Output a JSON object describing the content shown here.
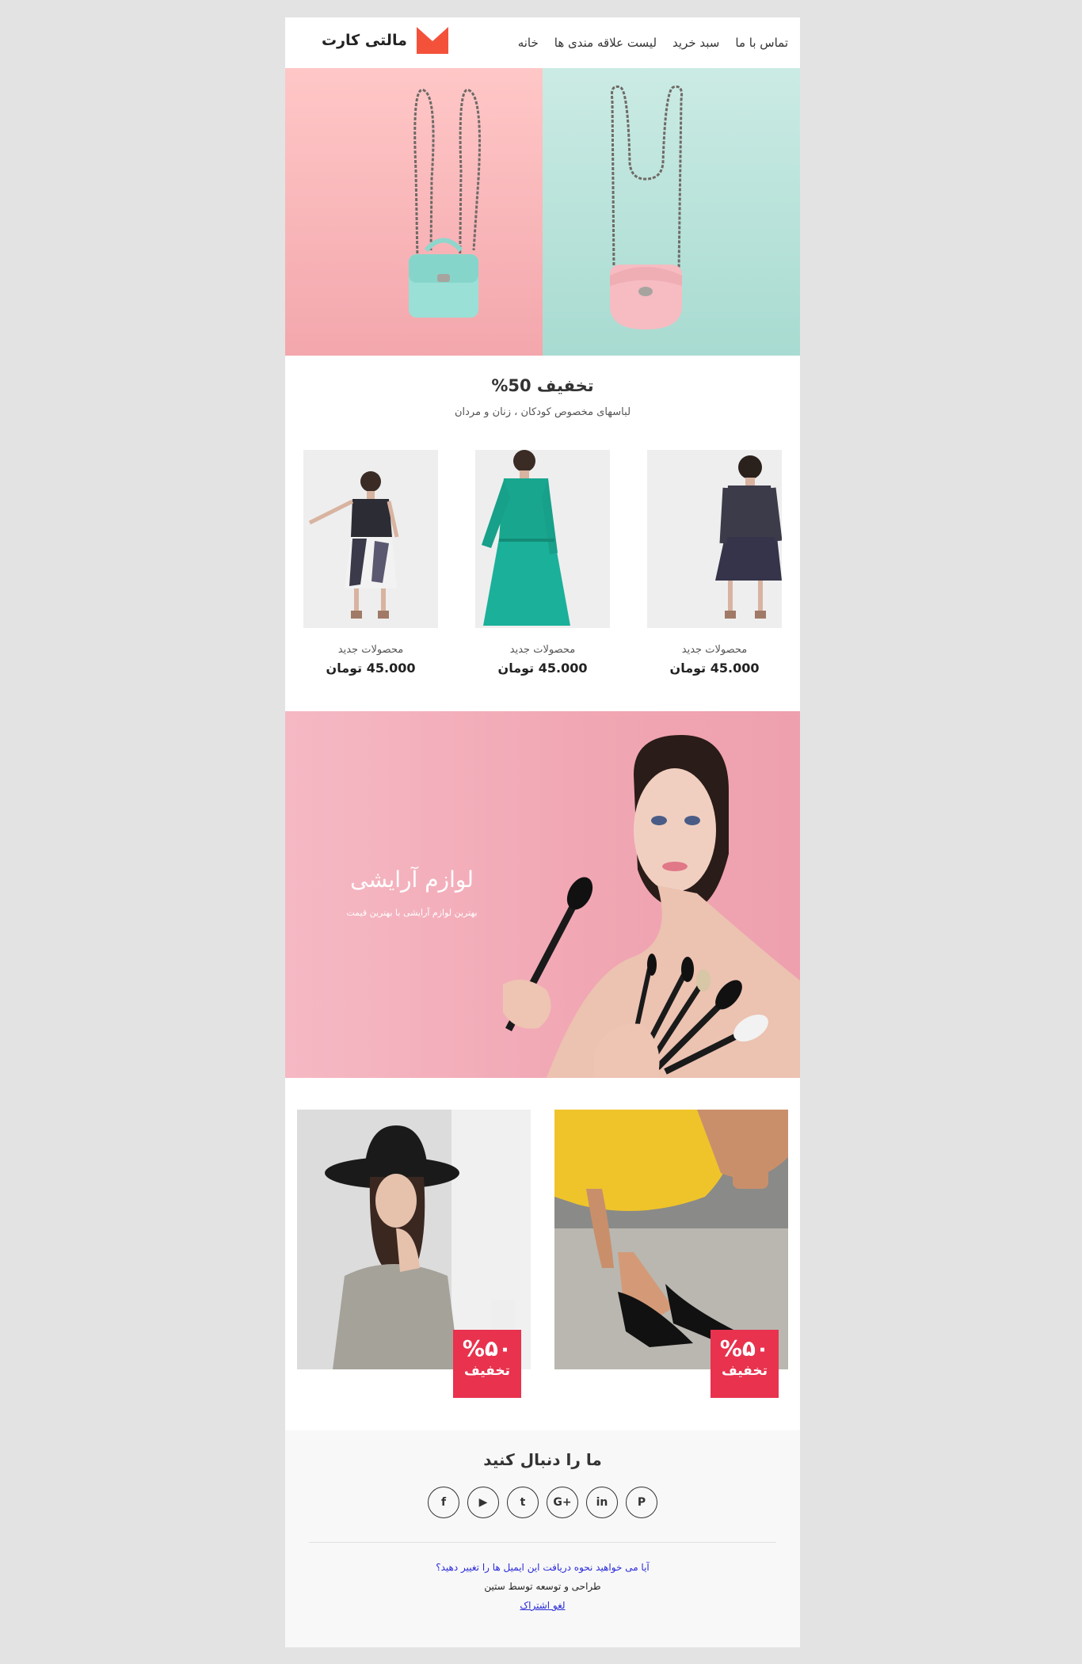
{
  "brand": {
    "name": "مالتی کارت",
    "accent": "#f4513b"
  },
  "nav": {
    "items": [
      {
        "label": "تماس با ما"
      },
      {
        "label": "سبد خرید"
      },
      {
        "label": "لیست علاقه مندی ها"
      },
      {
        "label": "خانه"
      }
    ]
  },
  "promo": {
    "title": "تخفیف 50%",
    "subtitle": "لباسهای مخصوص کودکان ، زنان و مردان"
  },
  "products": [
    {
      "label": "محصولات جدید",
      "price": "45.000 تومان",
      "dress_color": "#3c3b4a"
    },
    {
      "label": "محصولات جدید",
      "price": "45.000 تومان",
      "dress_color": "#19a68f"
    },
    {
      "label": "محصولات جدید",
      "price": "45.000 تومان",
      "dress_color": "#2a2a36"
    }
  ],
  "beauty": {
    "title": "لوازم آرایشی",
    "subtitle": "بهترین لوازم آرایشی با بهترین قیمت"
  },
  "offers": [
    {
      "percent": "%۵۰",
      "label": "تخفیف"
    },
    {
      "percent": "%۵۰",
      "label": "تخفیف"
    }
  ],
  "footer": {
    "follow": "ما را دنبال کنید",
    "socials": [
      {
        "icon": "facebook-icon",
        "glyph": "f"
      },
      {
        "icon": "youtube-icon",
        "glyph": "▶"
      },
      {
        "icon": "twitter-icon",
        "glyph": "t"
      },
      {
        "icon": "google-plus-icon",
        "glyph": "G+"
      },
      {
        "icon": "linkedin-icon",
        "glyph": "in"
      },
      {
        "icon": "pinterest-icon",
        "glyph": "P"
      }
    ],
    "question": "آیا می خواهید نحوه دریافت این ایمیل ها را تغییر دهید؟",
    "credit": "طراحی و توسعه توسط ستین",
    "unsubscribe": "لغو اشتراک"
  }
}
